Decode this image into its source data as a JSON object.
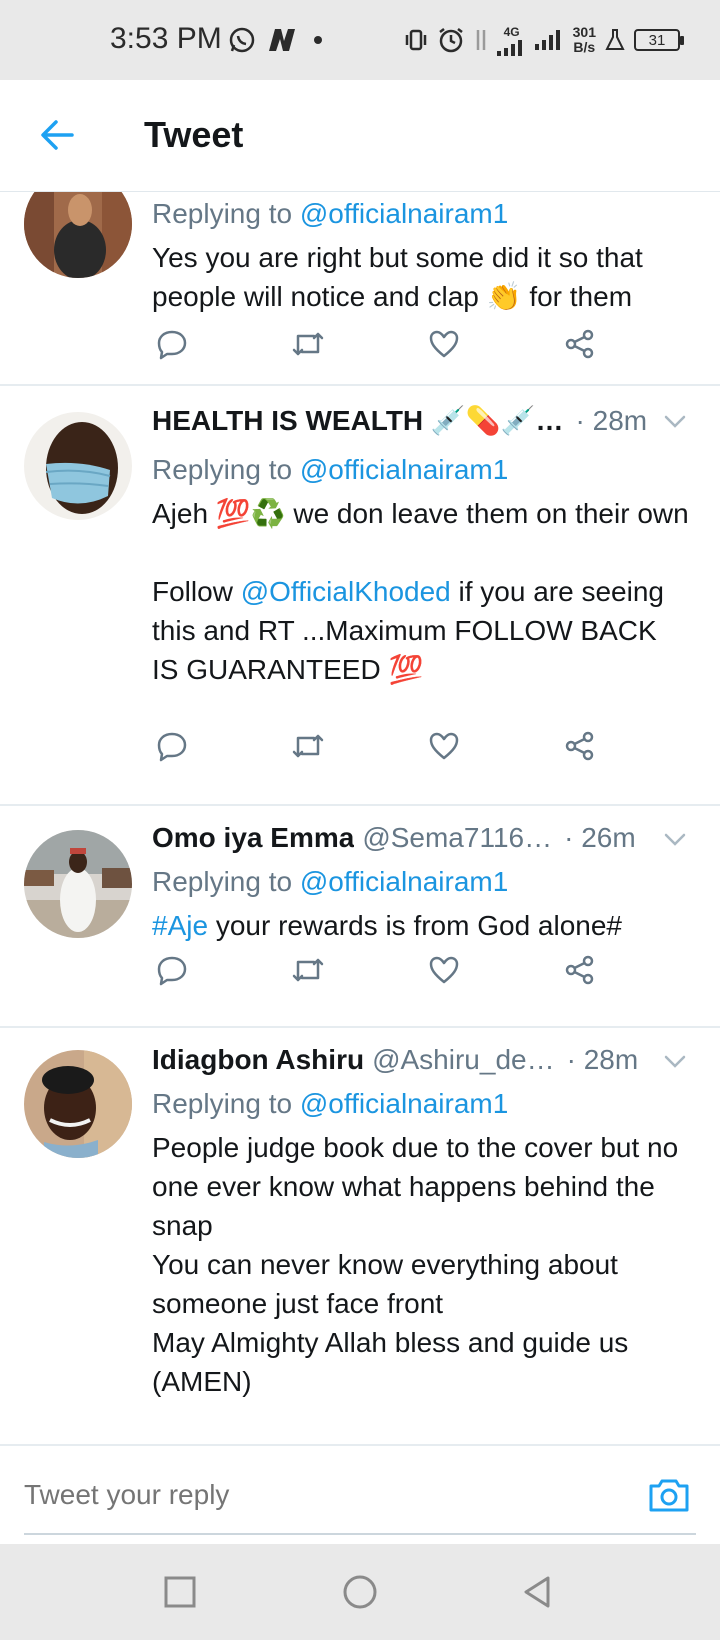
{
  "status_bar": {
    "time": "3:53 PM",
    "network_type": "4G",
    "net_speed_value": "301",
    "net_speed_unit": "B/s",
    "battery": "31"
  },
  "header": {
    "title": "Tweet"
  },
  "tweets": [
    {
      "display_name": "",
      "handle": "",
      "time": "",
      "replying_prefix": "Replying to",
      "replying_to": "@officialnairam1",
      "text_line1": "Yes you are right but some did it so that",
      "text_line2_a": "people will notice and clap ",
      "text_line2_emoji": "👏",
      "text_line2_b": " for them"
    },
    {
      "display_name": "HEALTH IS WEALTH 💉💊💉…",
      "handle": "",
      "time": "· 28m",
      "replying_prefix": "Replying to",
      "replying_to": "@officialnairam1",
      "para1_a": "Ajeh ",
      "para1_emoji": "💯♻️",
      "para1_b": " we don leave them on their own",
      "para2_a": "Follow ",
      "para2_mention": "@OfficialKhoded",
      "para2_b": " if you are seeing this and RT ...Maximum FOLLOW BACK IS GUARANTEED ",
      "para2_emoji": "💯"
    },
    {
      "display_name": "Omo iya Emma",
      "handle": "@Sema7116…",
      "time": "· 26m",
      "replying_prefix": "Replying to",
      "replying_to": "@officialnairam1",
      "hashtag": "#Aje",
      "text": " your rewards is from God alone#"
    },
    {
      "display_name": "Idiagbon Ashiru",
      "handle": "@Ashiru_de…",
      "time": "· 28m",
      "replying_prefix": "Replying to",
      "replying_to": "@officialnairam1",
      "text": "People judge book due to the cover but no one ever know what happens behind the snap\nYou can never know everything about someone just face front\nMay Almighty Allah bless and guide us (AMEN)"
    }
  ],
  "composer": {
    "placeholder": "Tweet your reply"
  },
  "colors": {
    "accent": "#1da1f2",
    "link": "#1b95e0",
    "secondary_text": "#657786",
    "divider": "#e6ecf0"
  },
  "icons": {
    "back": "arrow-left-icon",
    "reply": "reply-icon",
    "retweet": "retweet-icon",
    "like": "heart-icon",
    "share": "share-icon",
    "camera": "camera-icon",
    "caret": "chevron-down-icon"
  }
}
